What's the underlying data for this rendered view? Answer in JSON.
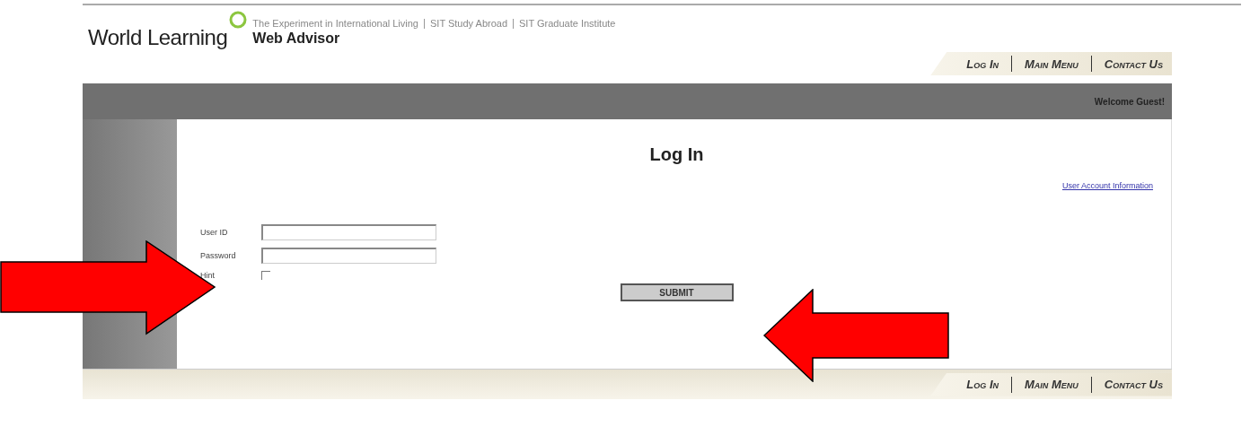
{
  "header": {
    "logo": "World Learning",
    "tagline": [
      "The Experiment in International Living",
      "SIT Study Abroad",
      "SIT Graduate Institute"
    ],
    "app_title": "Web Advisor"
  },
  "nav_top": [
    "Log In",
    "Main Menu",
    "Contact Us"
  ],
  "welcome": "Welcome Guest!",
  "form": {
    "title": "Log In",
    "account_link": "User Account Information",
    "fields": [
      {
        "label": "User ID",
        "kind": "text"
      },
      {
        "label": "Password",
        "kind": "password"
      },
      {
        "label": "Hint",
        "kind": "checkbox",
        "checked": false
      }
    ],
    "submit": "SUBMIT"
  },
  "nav_bottom": [
    "Log In",
    "Main Menu",
    "Contact Us"
  ],
  "annotations": [
    {
      "kind": "arrow-right"
    },
    {
      "kind": "arrow-left"
    }
  ]
}
